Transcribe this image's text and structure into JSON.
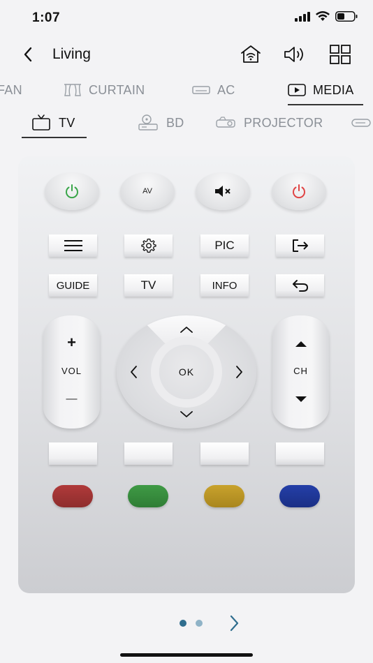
{
  "status": {
    "time": "1:07"
  },
  "header": {
    "title": "Living"
  },
  "category_tabs": [
    "FAN",
    "CURTAIN",
    "AC",
    "MEDIA"
  ],
  "device_tabs": [
    "TV",
    "BD",
    "PROJECTOR"
  ],
  "remote": {
    "av_label": "AV",
    "pic_label": "PIC",
    "guide_label": "GUIDE",
    "tv_label": "TV",
    "info_label": "INFO",
    "vol_plus": "+",
    "vol_label": "VOL",
    "vol_minus": "—",
    "ok_label": "OK",
    "ch_label": "CH"
  },
  "colors": {
    "power_on": "#3aa64a",
    "power_off": "#e04545",
    "red": "#b03a3a",
    "green": "#3f9a45",
    "yellow": "#c9a22c",
    "blue": "#243fa8",
    "pager_active": "#2f6d8e",
    "pager_inactive": "#8fb3c7",
    "pager_arrow": "#2f6d8e"
  },
  "pager": {
    "pages": 2,
    "active_page": 1
  }
}
